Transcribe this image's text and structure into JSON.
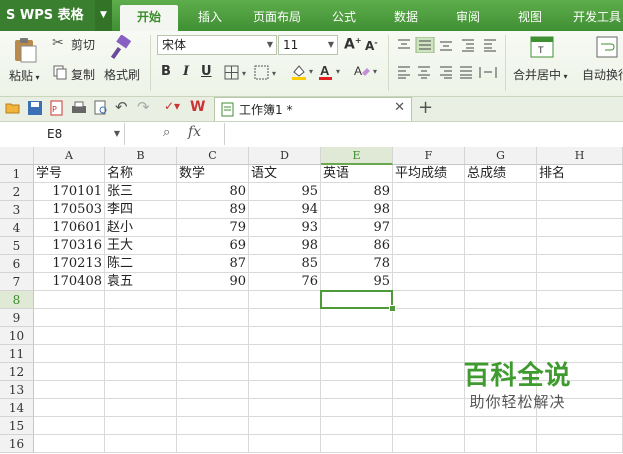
{
  "app": {
    "logo_label": "S WPS 表格",
    "tabs": [
      "开始",
      "插入",
      "页面布局",
      "公式",
      "数据",
      "审阅",
      "视图",
      "开发工具"
    ]
  },
  "ribbon": {
    "paste_label": "粘贴",
    "cut_label": "剪切",
    "copy_label": "复制",
    "format_painter_label": "格式刷",
    "font_name": "宋体",
    "font_size": "11",
    "bold": "B",
    "italic": "I",
    "underline": "U",
    "merge_center_label": "合并居中",
    "wrap_label": "自动换行"
  },
  "document": {
    "tab_title": "工作簿1 *"
  },
  "formula_bar": {
    "name_box": "E8",
    "fx": "fx",
    "value": ""
  },
  "sheet": {
    "columns": [
      "A",
      "B",
      "C",
      "D",
      "E",
      "F",
      "G",
      "H"
    ],
    "selected_column": "E",
    "selected_row": 8,
    "rows": [
      [
        "学号",
        "名称",
        "数学",
        "语文",
        "英语",
        "平均成绩",
        "总成绩",
        "排名"
      ],
      [
        "170101",
        "张三",
        "80",
        "95",
        "89",
        "",
        "",
        ""
      ],
      [
        "170503",
        "李四",
        "89",
        "94",
        "98",
        "",
        "",
        ""
      ],
      [
        "170601",
        "赵小",
        "79",
        "93",
        "97",
        "",
        "",
        ""
      ],
      [
        "170316",
        "王大",
        "69",
        "98",
        "86",
        "",
        "",
        ""
      ],
      [
        "170213",
        "陈二",
        "87",
        "85",
        "78",
        "",
        "",
        ""
      ],
      [
        "170408",
        "袁五",
        "90",
        "76",
        "95",
        "",
        "",
        ""
      ]
    ],
    "row_count": 16
  },
  "watermark": {
    "title": "百科全说",
    "subtitle": "助你轻松解决"
  },
  "colors": {
    "accent": "#3f8f33",
    "selection": "#4e9a3a"
  }
}
